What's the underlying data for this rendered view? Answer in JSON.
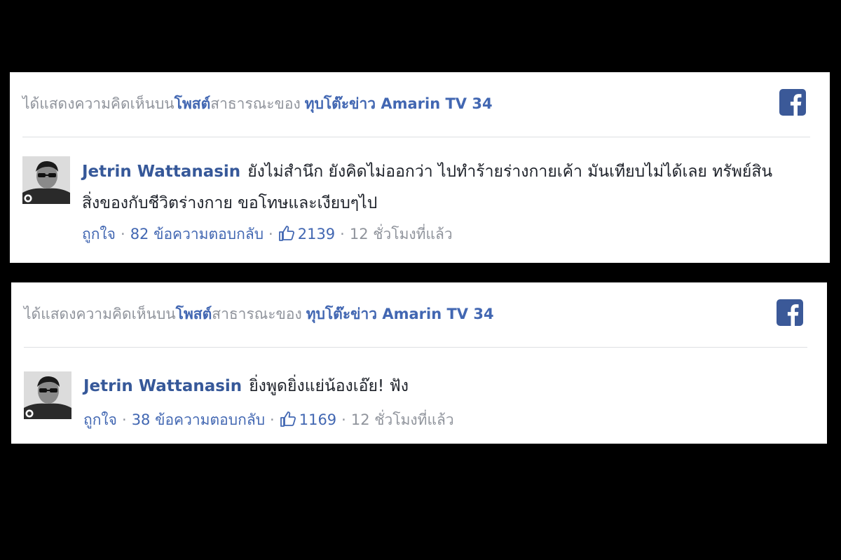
{
  "colors": {
    "background": "#000000",
    "card": "#ffffff",
    "link_blue": "#4267b2",
    "muted_gray": "#90949c",
    "facebook_blue": "#3b5998"
  },
  "cards": [
    {
      "header": {
        "prefix": "ได้แสดงความคิดเห็นบน",
        "post_link": "โพสต์",
        "suffix": "สาธารณะของ",
        "page_name": "ทุบโต๊ะข่าว Amarin TV 34"
      },
      "icon": "facebook-icon",
      "comment": {
        "author": "Jetrin Wattanasin",
        "text": "ยังไม่สำนึก ยังคิดไม่ออกว่า ไปทำร้ายร่างกายเค้า มันเทียบไม่ได้เลย ทรัพย์สินสิ่งของกับชีวิตร่างกาย ขอโทษและเงียบๆไป"
      },
      "actions": {
        "like_label": "ถูกใจ",
        "replies": "82 ข้อความตอบกลับ",
        "like_icon": "thumbs-up-icon",
        "like_count": "2139",
        "time": "12 ชั่วโมงที่แล้ว"
      }
    },
    {
      "header": {
        "prefix": "ได้แสดงความคิดเห็นบน",
        "post_link": "โพสต์",
        "suffix": "สาธารณะของ",
        "page_name": "ทุบโต๊ะข่าว Amarin TV 34"
      },
      "icon": "facebook-icon",
      "comment": {
        "author": "Jetrin Wattanasin",
        "text": "ยิ่งพูดยิ่งแย่น้องเอ๊ย! ฟัง"
      },
      "actions": {
        "like_label": "ถูกใจ",
        "replies": "38 ข้อความตอบกลับ",
        "like_icon": "thumbs-up-icon",
        "like_count": "1169",
        "time": "12 ชั่วโมงที่แล้ว"
      }
    }
  ]
}
